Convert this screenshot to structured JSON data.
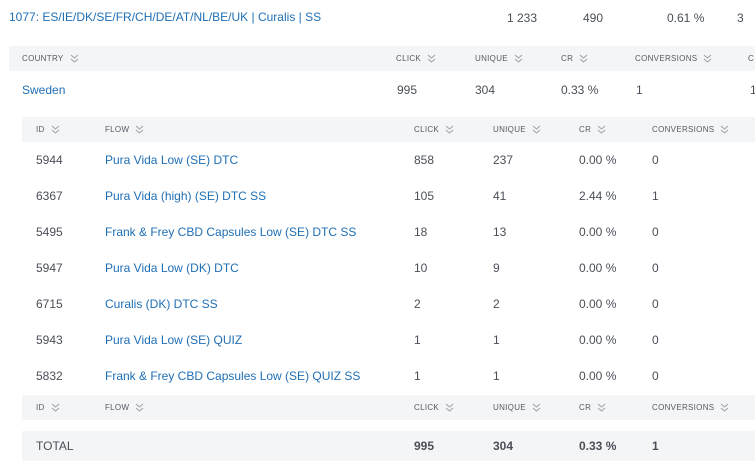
{
  "top_row": {
    "title": "1077: ES/IE/DK/SE/FR/CH/DE/AT/NL/BE/UK | Curalis | SS",
    "click": "1 233",
    "unique": "490",
    "cr": "0.61 %",
    "conversions": "3"
  },
  "country_header": {
    "country": "COUNTRY",
    "click": "CLICK",
    "unique": "UNIQUE",
    "cr": "CR",
    "conversions": "CONVERSIONS",
    "extra": "C"
  },
  "country_row": {
    "name": "Sweden",
    "click": "995",
    "unique": "304",
    "cr": "0.33 %",
    "conversions": "1",
    "extra": "1"
  },
  "flow_header": {
    "id": "ID",
    "flow": "FLOW",
    "click": "CLICK",
    "unique": "UNIQUE",
    "cr": "CR",
    "conversions": "CONVERSIONS"
  },
  "flows": [
    {
      "id": "5944",
      "flow": "Pura Vida Low (SE) DTC",
      "click": "858",
      "unique": "237",
      "cr": "0.00 %",
      "conversions": "0"
    },
    {
      "id": "6367",
      "flow": "Pura Vida (high) (SE) DTC SS",
      "click": "105",
      "unique": "41",
      "cr": "2.44 %",
      "conversions": "1"
    },
    {
      "id": "5495",
      "flow": "Frank & Frey CBD Capsules Low (SE) DTC SS",
      "click": "18",
      "unique": "13",
      "cr": "0.00 %",
      "conversions": "0"
    },
    {
      "id": "5947",
      "flow": "Pura Vida Low (DK) DTC",
      "click": "10",
      "unique": "9",
      "cr": "0.00 %",
      "conversions": "0"
    },
    {
      "id": "6715",
      "flow": "Curalis (DK) DTC SS",
      "click": "2",
      "unique": "2",
      "cr": "0.00 %",
      "conversions": "0"
    },
    {
      "id": "5943",
      "flow": "Pura Vida Low (SE) QUIZ",
      "click": "1",
      "unique": "1",
      "cr": "0.00 %",
      "conversions": "0"
    },
    {
      "id": "5832",
      "flow": "Frank & Frey CBD Capsules Low (SE) QUIZ SS",
      "click": "1",
      "unique": "1",
      "cr": "0.00 %",
      "conversions": "0"
    }
  ],
  "total_row": {
    "label": "TOTAL",
    "click": "995",
    "unique": "304",
    "cr": "0.33 %",
    "conversions": "1"
  },
  "icons": {
    "sort": "sort-chevron-icon"
  },
  "colors": {
    "link": "#1f6fb5",
    "header_band": "#f4f5f7"
  }
}
